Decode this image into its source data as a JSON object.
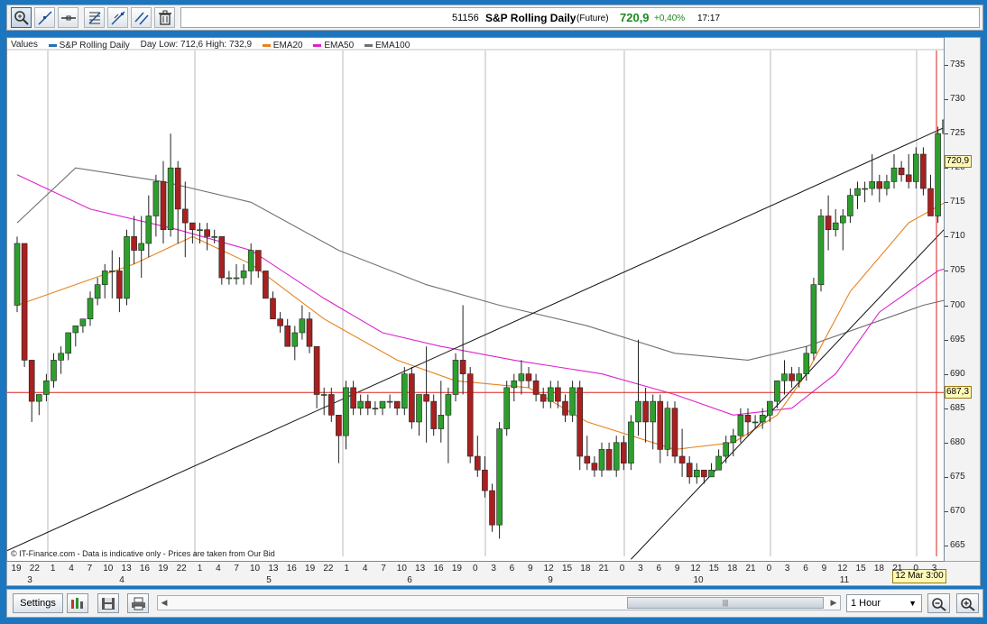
{
  "toolbar": {
    "tools": [
      {
        "name": "zoom-icon"
      },
      {
        "name": "line-icon"
      },
      {
        "name": "horizontal-line-icon"
      },
      {
        "name": "fibonacci-icon"
      },
      {
        "name": "trend-channel-icon"
      },
      {
        "name": "parallel-lines-icon"
      },
      {
        "name": "trash-icon"
      }
    ]
  },
  "ticker": {
    "code": "51156",
    "name": "S&P Rolling Daily",
    "type": "(Future)",
    "price": "720,9",
    "change": "+0,40%",
    "time": "17:17",
    "price_color": "#1b8c1b"
  },
  "legend": {
    "values_label": "Values",
    "series_label": "S&P Rolling Daily",
    "day_range": "Day Low: 712,6 High: 732,9",
    "ema20": "EMA20",
    "ema50": "EMA50",
    "ema100": "EMA100",
    "series_color": "#2a6fb0",
    "ema20_color": "#e8821c",
    "ema50_color": "#dd22cc",
    "ema100_color": "#707070"
  },
  "footer_note": "© IT-Finance.com - Data is indicative only - Prices are taken from Our Bid",
  "price_axis": {
    "ticks": [
      "735",
      "730",
      "725",
      "720",
      "715",
      "710",
      "705",
      "700",
      "695",
      "690",
      "685",
      "680",
      "675",
      "670",
      "665"
    ],
    "last_price": "720,9",
    "crosshair_price": "687,3"
  },
  "time_axis": {
    "hours": [
      "19",
      "22",
      "1",
      "4",
      "7",
      "10",
      "13",
      "16",
      "19",
      "22",
      "1",
      "4",
      "7",
      "10",
      "13",
      "16",
      "19",
      "22",
      "1",
      "4",
      "7",
      "10",
      "13",
      "16",
      "19",
      "0",
      "3",
      "6",
      "9",
      "12",
      "15",
      "18",
      "21",
      "0",
      "3",
      "6",
      "9",
      "12",
      "15",
      "18",
      "21",
      "0",
      "3",
      "6",
      "9",
      "12",
      "15",
      "18",
      "21",
      "0",
      "3"
    ],
    "days": [
      "3",
      "4",
      "5",
      "6",
      "9",
      "10",
      "11"
    ],
    "cursor_time": "12 Mar 3:00"
  },
  "chart_data": {
    "type": "candlestick",
    "ylim": [
      663,
      737
    ],
    "candles": [
      [
        700,
        710,
        699,
        709
      ],
      [
        709,
        709,
        691,
        692
      ],
      [
        692,
        692,
        683,
        686
      ],
      [
        686,
        687,
        684,
        687
      ],
      [
        687,
        690,
        686,
        689
      ],
      [
        689,
        693,
        688,
        692
      ],
      [
        692,
        694,
        690,
        693
      ],
      [
        693,
        696,
        692,
        696
      ],
      [
        696,
        697,
        694,
        697
      ],
      [
        697,
        698,
        696,
        698
      ],
      [
        698,
        702,
        697,
        701
      ],
      [
        701,
        704,
        700,
        703
      ],
      [
        703,
        706,
        701,
        705
      ],
      [
        705,
        708,
        701,
        705
      ],
      [
        705,
        707,
        699,
        701
      ],
      [
        701,
        711,
        700,
        710
      ],
      [
        710,
        713,
        706,
        708
      ],
      [
        708,
        713,
        704,
        709
      ],
      [
        709,
        716,
        707,
        713
      ],
      [
        713,
        719,
        710,
        718
      ],
      [
        718,
        721,
        709,
        711
      ],
      [
        711,
        725,
        710,
        720
      ],
      [
        720,
        721,
        709,
        714
      ],
      [
        714,
        718,
        707,
        712
      ],
      [
        712,
        712,
        709,
        711
      ],
      [
        711,
        712,
        709,
        711
      ],
      [
        711,
        712,
        708,
        710
      ],
      [
        710,
        711,
        709,
        710
      ],
      [
        710,
        710,
        703,
        704
      ],
      [
        704,
        705,
        703,
        704
      ],
      [
        704,
        706,
        703,
        704
      ],
      [
        704,
        706,
        703,
        705
      ],
      [
        705,
        709,
        703,
        708
      ],
      [
        708,
        708,
        704,
        705
      ],
      [
        705,
        705,
        701,
        701
      ],
      [
        701,
        702,
        698,
        698
      ],
      [
        698,
        699,
        696,
        697
      ],
      [
        697,
        698,
        694,
        694
      ],
      [
        694,
        697,
        692,
        696
      ],
      [
        696,
        700,
        695,
        698
      ],
      [
        698,
        699,
        693,
        694
      ],
      [
        694,
        694,
        685,
        687
      ],
      [
        687,
        688,
        684,
        687
      ],
      [
        687,
        688,
        683,
        684
      ],
      [
        684,
        684,
        677,
        681
      ],
      [
        681,
        689,
        679,
        688
      ],
      [
        688,
        689,
        684,
        685
      ],
      [
        685,
        687,
        684,
        686
      ],
      [
        686,
        687,
        684,
        685
      ],
      [
        685,
        686,
        684,
        685
      ],
      [
        685,
        686,
        684,
        686
      ],
      [
        686,
        687,
        685,
        686
      ],
      [
        686,
        686,
        684,
        685
      ],
      [
        685,
        691,
        684,
        690
      ],
      [
        690,
        691,
        682,
        683
      ],
      [
        683,
        687,
        681,
        687
      ],
      [
        687,
        694,
        680,
        686
      ],
      [
        686,
        687,
        681,
        682
      ],
      [
        682,
        689,
        680,
        684
      ],
      [
        684,
        688,
        677,
        687
      ],
      [
        687,
        693,
        686,
        692
      ],
      [
        692,
        700,
        687,
        690
      ],
      [
        690,
        691,
        677,
        678
      ],
      [
        678,
        681,
        675,
        676
      ],
      [
        676,
        678,
        672,
        673
      ],
      [
        673,
        674,
        667,
        668
      ],
      [
        668,
        683,
        666,
        682
      ],
      [
        682,
        689,
        681,
        688
      ],
      [
        688,
        690,
        686,
        689
      ],
      [
        689,
        692,
        687,
        690
      ],
      [
        690,
        691,
        688,
        689
      ],
      [
        689,
        690,
        686,
        687
      ],
      [
        687,
        688,
        685,
        686
      ],
      [
        686,
        689,
        685,
        688
      ],
      [
        688,
        689,
        685,
        686
      ],
      [
        686,
        687,
        683,
        684
      ],
      [
        684,
        689,
        683,
        688
      ],
      [
        688,
        689,
        676,
        678
      ],
      [
        678,
        681,
        676,
        677
      ],
      [
        677,
        678,
        675,
        676
      ],
      [
        676,
        680,
        675,
        679
      ],
      [
        679,
        680,
        676,
        676
      ],
      [
        676,
        681,
        675,
        680
      ],
      [
        680,
        681,
        676,
        677
      ],
      [
        677,
        684,
        676,
        683
      ],
      [
        683,
        695,
        681,
        686
      ],
      [
        686,
        688,
        680,
        683
      ],
      [
        683,
        687,
        679,
        686
      ],
      [
        686,
        687,
        677,
        679
      ],
      [
        679,
        686,
        678,
        685
      ],
      [
        685,
        686,
        677,
        678
      ],
      [
        678,
        682,
        675,
        677
      ],
      [
        677,
        678,
        674,
        675
      ],
      [
        675,
        677,
        674,
        676
      ],
      [
        676,
        676,
        674,
        675
      ],
      [
        675,
        677,
        675,
        676
      ],
      [
        676,
        679,
        676,
        678
      ],
      [
        678,
        681,
        677,
        680
      ],
      [
        680,
        682,
        678,
        681
      ],
      [
        681,
        685,
        680,
        684
      ],
      [
        684,
        685,
        681,
        683
      ],
      [
        683,
        684,
        682,
        683
      ],
      [
        683,
        685,
        682,
        684
      ],
      [
        684,
        686,
        683,
        686
      ],
      [
        686,
        689,
        685,
        689
      ],
      [
        689,
        692,
        687,
        690
      ],
      [
        690,
        691,
        688,
        689
      ],
      [
        689,
        691,
        688,
        690
      ],
      [
        690,
        694,
        689,
        693
      ],
      [
        693,
        704,
        692,
        703
      ],
      [
        703,
        714,
        702,
        713
      ],
      [
        713,
        716,
        708,
        711
      ],
      [
        711,
        714,
        710,
        712
      ],
      [
        712,
        714,
        708,
        713
      ],
      [
        713,
        717,
        712,
        716
      ],
      [
        716,
        718,
        714,
        717
      ],
      [
        717,
        718,
        715,
        717
      ],
      [
        717,
        722,
        716,
        718
      ],
      [
        718,
        719,
        715,
        717
      ],
      [
        717,
        719,
        716,
        718
      ],
      [
        718,
        722,
        717,
        720
      ],
      [
        720,
        721,
        718,
        719
      ],
      [
        719,
        722,
        717,
        718
      ],
      [
        718,
        723,
        717,
        722
      ],
      [
        722,
        723,
        716,
        717
      ],
      [
        717,
        719,
        713,
        713
      ],
      [
        713,
        726,
        712,
        725
      ],
      [
        725,
        729,
        721,
        727
      ],
      [
        727,
        729,
        722,
        724
      ],
      [
        724,
        733,
        719,
        731
      ],
      [
        731,
        732,
        722,
        729
      ],
      [
        729,
        730,
        718,
        723
      ]
    ],
    "last_candle": [
      718,
      721,
      717,
      721
    ],
    "ema20": [
      [
        0,
        700
      ],
      [
        16,
        706
      ],
      [
        24,
        710
      ],
      [
        32,
        706
      ],
      [
        42,
        698
      ],
      [
        52,
        692
      ],
      [
        60,
        689
      ],
      [
        70,
        688
      ],
      [
        78,
        683
      ],
      [
        90,
        679
      ],
      [
        98,
        680
      ],
      [
        104,
        684
      ],
      [
        108,
        690
      ],
      [
        114,
        702
      ],
      [
        122,
        712
      ],
      [
        132,
        718
      ],
      [
        138,
        720
      ]
    ],
    "ema50": [
      [
        0,
        719
      ],
      [
        10,
        714
      ],
      [
        22,
        711
      ],
      [
        32,
        708
      ],
      [
        42,
        701
      ],
      [
        50,
        696
      ],
      [
        58,
        694
      ],
      [
        68,
        692
      ],
      [
        80,
        690
      ],
      [
        90,
        687
      ],
      [
        98,
        684
      ],
      [
        106,
        685
      ],
      [
        112,
        690
      ],
      [
        118,
        699
      ],
      [
        126,
        705
      ],
      [
        138,
        709
      ]
    ],
    "ema100": [
      [
        0,
        712
      ],
      [
        8,
        720
      ],
      [
        20,
        718
      ],
      [
        32,
        715
      ],
      [
        44,
        708
      ],
      [
        56,
        703
      ],
      [
        66,
        700
      ],
      [
        78,
        697
      ],
      [
        90,
        693
      ],
      [
        100,
        692
      ],
      [
        108,
        694
      ],
      [
        116,
        697
      ],
      [
        124,
        700
      ],
      [
        132,
        702
      ],
      [
        138,
        704
      ]
    ],
    "trendlines": [
      {
        "from": [
          -4,
          663
        ],
        "to": [
          150,
          737
        ]
      },
      {
        "from": [
          84,
          663
        ],
        "to": [
          150,
          737
        ]
      }
    ],
    "crosshair_price": 687.3
  }
}
